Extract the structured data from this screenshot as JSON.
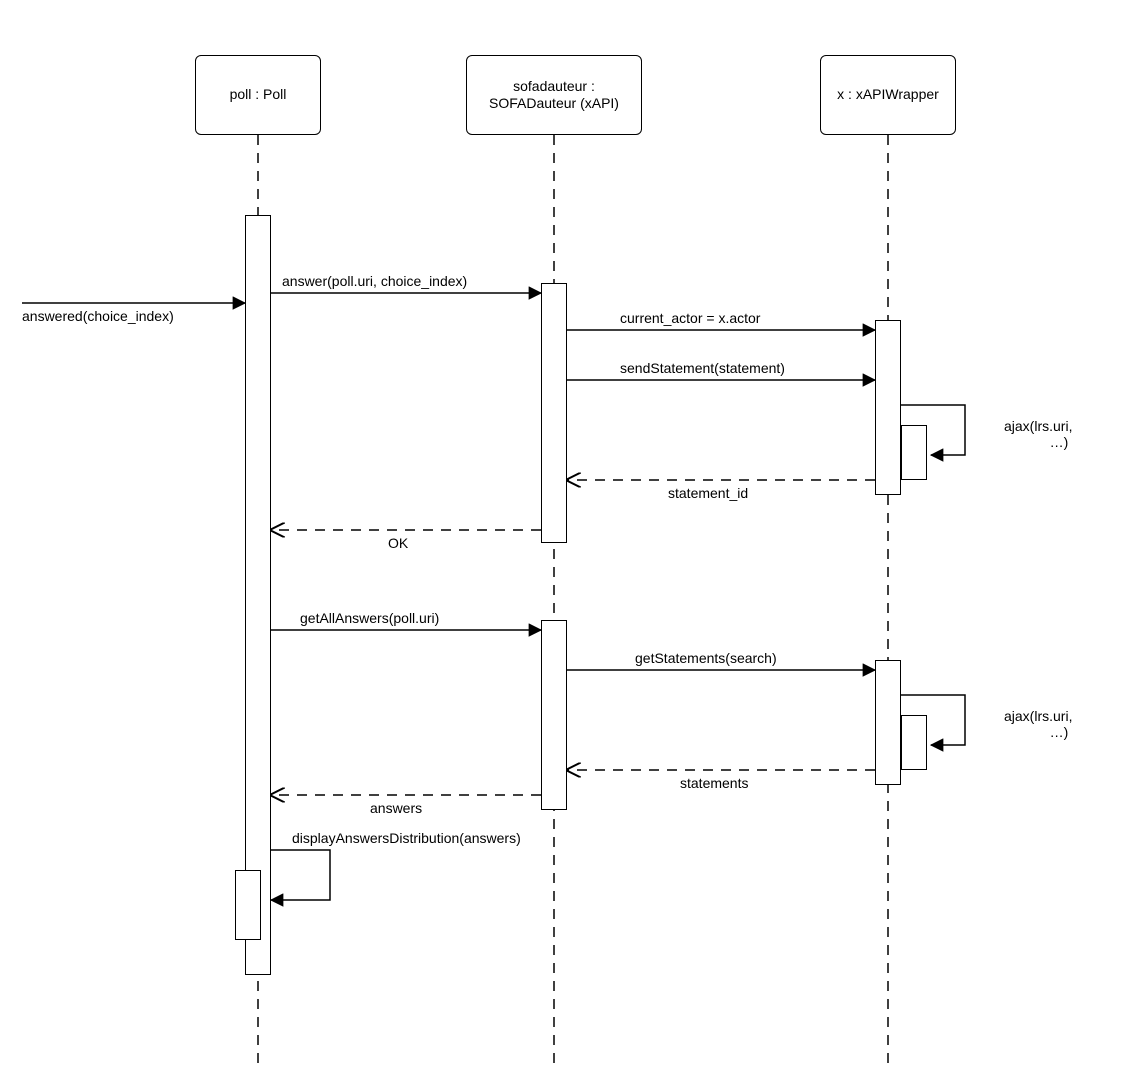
{
  "participants": {
    "poll": {
      "line1": "poll : Poll",
      "line2": ""
    },
    "sofa": {
      "line1": "sofadauteur :",
      "line2": "SOFADauteur (xAPI)"
    },
    "xapi": {
      "line1": "x : xAPIWrapper",
      "line2": ""
    }
  },
  "messages": {
    "answered": "answered(choice_index)",
    "answer": "answer(poll.uri, choice_index)",
    "current_actor": "current_actor = x.actor",
    "sendStatement": "sendStatement(statement)",
    "ajax1_l1": "ajax(lrs.uri,",
    "ajax1_l2": "…)",
    "statement_id": "statement_id",
    "ok": "OK",
    "getAllAnswers": "getAllAnswers(poll.uri)",
    "getStatements": "getStatements(search)",
    "ajax2_l1": "ajax(lrs.uri,",
    "ajax2_l2": "…)",
    "statements": "statements",
    "answers": "answers",
    "displayAnswers": "displayAnswersDistribution(answers)"
  },
  "chart_data": {
    "type": "sequence-diagram",
    "participants": [
      {
        "id": "poll",
        "label": "poll : Poll"
      },
      {
        "id": "sofa",
        "label": "sofadauteur : SOFADauteur (xAPI)"
      },
      {
        "id": "xapi",
        "label": "x : xAPIWrapper"
      }
    ],
    "events": [
      {
        "from": "external",
        "to": "poll",
        "text": "answered(choice_index)",
        "kind": "call"
      },
      {
        "from": "poll",
        "to": "sofa",
        "text": "answer(poll.uri, choice_index)",
        "kind": "call"
      },
      {
        "from": "sofa",
        "to": "xapi",
        "text": "current_actor = x.actor",
        "kind": "call"
      },
      {
        "from": "sofa",
        "to": "xapi",
        "text": "sendStatement(statement)",
        "kind": "call"
      },
      {
        "from": "xapi",
        "to": "xapi",
        "text": "ajax(lrs.uri, …)",
        "kind": "self"
      },
      {
        "from": "xapi",
        "to": "sofa",
        "text": "statement_id",
        "kind": "return"
      },
      {
        "from": "sofa",
        "to": "poll",
        "text": "OK",
        "kind": "return"
      },
      {
        "from": "poll",
        "to": "sofa",
        "text": "getAllAnswers(poll.uri)",
        "kind": "call"
      },
      {
        "from": "sofa",
        "to": "xapi",
        "text": "getStatements(search)",
        "kind": "call"
      },
      {
        "from": "xapi",
        "to": "xapi",
        "text": "ajax(lrs.uri, …)",
        "kind": "self"
      },
      {
        "from": "xapi",
        "to": "sofa",
        "text": "statements",
        "kind": "return"
      },
      {
        "from": "sofa",
        "to": "poll",
        "text": "answers",
        "kind": "return"
      },
      {
        "from": "poll",
        "to": "poll",
        "text": "displayAnswersDistribution(answers)",
        "kind": "self"
      }
    ]
  }
}
